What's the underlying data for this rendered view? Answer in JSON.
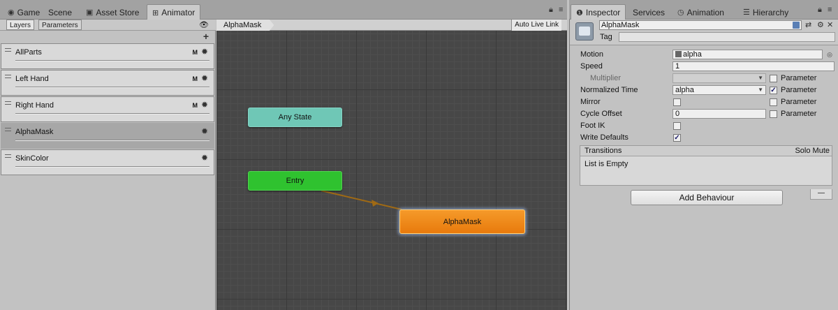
{
  "left_tabs": [
    {
      "label": "Game",
      "icon": "game-icon"
    },
    {
      "label": "Scene",
      "icon": "scene-icon"
    },
    {
      "label": "Asset Store",
      "icon": "asset-store-icon"
    },
    {
      "label": "Animator",
      "icon": "animator-icon",
      "active": true
    }
  ],
  "right_tabs": [
    {
      "label": "Inspector",
      "icon": "info-icon",
      "active": true
    },
    {
      "label": "Services",
      "icon": "services-icon"
    },
    {
      "label": "Animation",
      "icon": "animation-icon"
    },
    {
      "label": "Hierarchy",
      "icon": "hierarchy-icon"
    }
  ],
  "layers_panel": {
    "tabs": [
      "Layers",
      "Parameters"
    ],
    "layers": [
      {
        "name": "AllParts",
        "mask_badge": "M"
      },
      {
        "name": "Left Hand",
        "mask_badge": "M"
      },
      {
        "name": "Right Hand",
        "mask_badge": "M"
      },
      {
        "name": "AlphaMask",
        "mask_badge": "",
        "selected": true
      },
      {
        "name": "SkinColor",
        "mask_badge": ""
      }
    ]
  },
  "graph": {
    "breadcrumb": "AlphaMask",
    "auto_live_link": "Auto Live Link",
    "nodes": {
      "any_state": "Any State",
      "entry": "Entry",
      "alphamask": "AlphaMask"
    },
    "colors": {
      "any_state": "#6fc7b6",
      "entry": "#2fc22f",
      "default_state": "#e87a0c",
      "transition": "#a06a14"
    }
  },
  "inspector": {
    "state_name": "AlphaMask",
    "tag_label": "Tag",
    "tag_value": "",
    "properties": {
      "motion": {
        "label": "Motion",
        "value": "alpha"
      },
      "speed": {
        "label": "Speed",
        "value": "1"
      },
      "multiplier": {
        "label": "Multiplier",
        "value": "",
        "param_label": "Parameter",
        "param_checked": false
      },
      "normalized_time": {
        "label": "Normalized Time",
        "value": "alpha",
        "param_label": "Parameter",
        "param_checked": true
      },
      "mirror": {
        "label": "Mirror",
        "checked": false,
        "param_label": "Parameter",
        "param_checked": false
      },
      "cycle_offset": {
        "label": "Cycle Offset",
        "value": "0",
        "param_label": "Parameter",
        "param_checked": false
      },
      "foot_ik": {
        "label": "Foot IK",
        "checked": false
      },
      "write_defaults": {
        "label": "Write Defaults",
        "checked": true
      }
    },
    "transitions": {
      "title": "Transitions",
      "solo_mute": "Solo Mute",
      "empty_text": "List is Empty",
      "remove_label": "—"
    },
    "add_behaviour": "Add Behaviour"
  }
}
